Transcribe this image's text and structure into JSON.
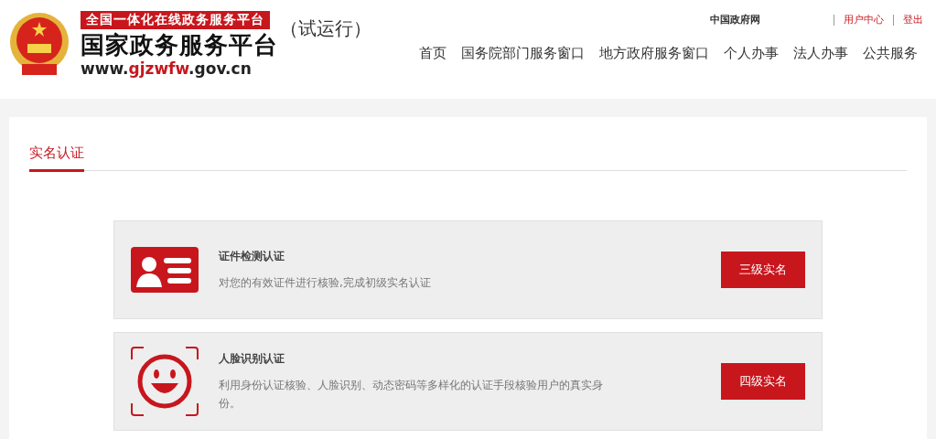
{
  "logo": {
    "banner": "全国一体化在线政务服务平台",
    "title": "国家政务服务平台",
    "url": {
      "prefix": "www.",
      "domain": "gjzwfw",
      "suffix": ".gov.cn"
    },
    "badge": "（试运行）"
  },
  "top_links": [
    {
      "label": "中国政府网",
      "kind": "plain"
    },
    {
      "label": "用户中心",
      "kind": "red"
    },
    {
      "label": "登出",
      "kind": "red"
    }
  ],
  "nav": [
    "首页",
    "国务院部门服务窗口",
    "地方政府服务窗口",
    "个人办事",
    "法人办事",
    "公共服务"
  ],
  "section": {
    "title": "实名认证"
  },
  "cards": [
    {
      "kind": "id-card",
      "title": "证件检测认证",
      "description": "对您的有效证件进行核验,完成初级实名认证",
      "button": "三级实名"
    },
    {
      "kind": "face",
      "title": "人脸识别认证",
      "description": "利用身份认证核验、人脸识别、动态密码等多样化的认证手段核验用户的真实身份。",
      "button": "四级实名"
    }
  ]
}
